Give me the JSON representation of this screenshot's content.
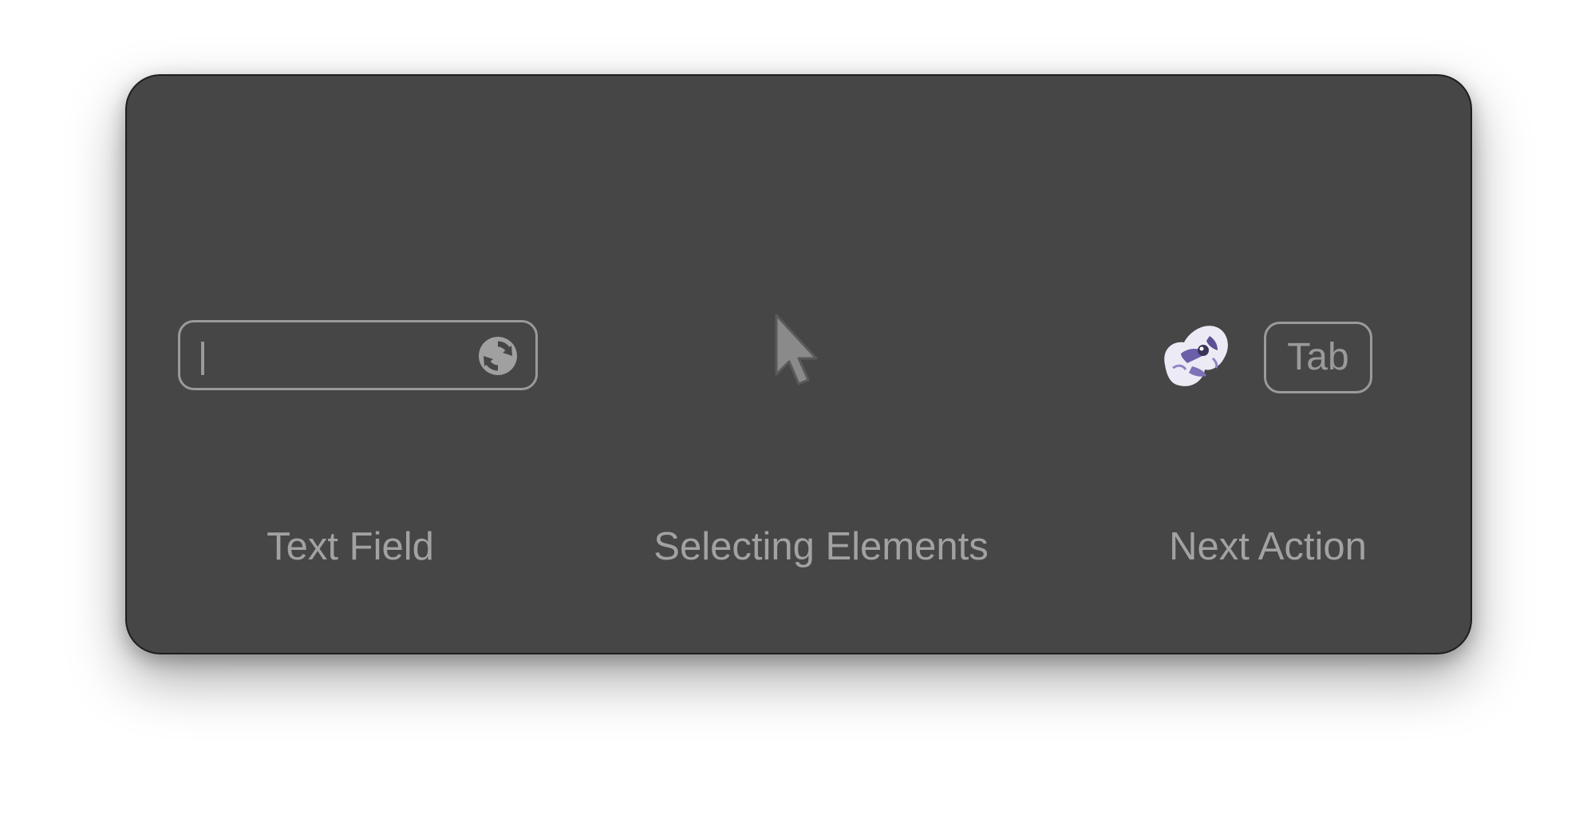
{
  "panel": {
    "background": "#464646",
    "border_color": "#1e1e1e",
    "muted_color": "#9a9a9a"
  },
  "text_field": {
    "value": "",
    "icon": "refresh-icon"
  },
  "pointer": {
    "icon": "mouse-pointer-icon"
  },
  "next_action": {
    "icon": "fetch-logo-icon",
    "key_label": "Tab"
  },
  "captions": {
    "text_field": "Text Field",
    "selecting_elements": "Selecting Elements",
    "next_action": "Next Action"
  }
}
